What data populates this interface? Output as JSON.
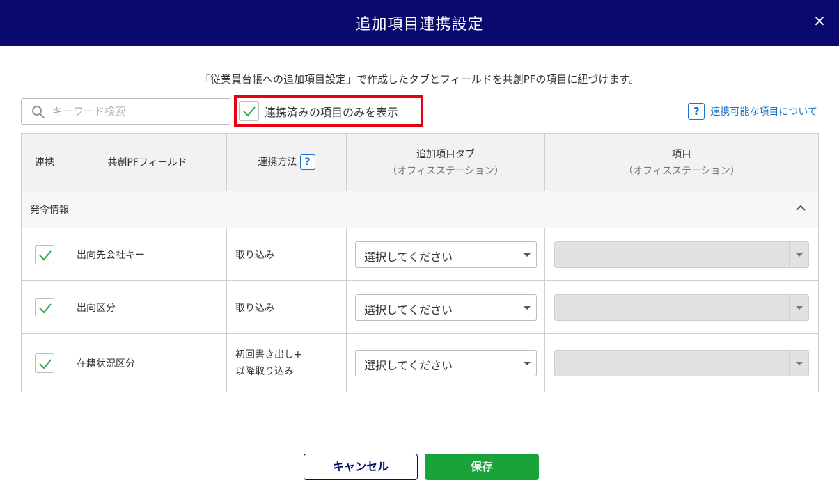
{
  "dialog": {
    "title": "追加項目連携設定",
    "close_label": "×",
    "description": "「従業員台帳への追加項目設定」で作成したタブとフィールドを共創PFの項目に紐づけます。"
  },
  "toolbar": {
    "search_placeholder": "キーワード検索",
    "filter_label": "連携済みの項目のみを表示",
    "filter_checked": true,
    "help_icon_label": "?",
    "help_link": "連携可能な項目について"
  },
  "table": {
    "headers": {
      "link": "連携",
      "field": "共創PFフィールド",
      "method": "連携方法",
      "method_help": "?",
      "tab": "追加項目タブ",
      "tab_sub": "（オフィスステーション）",
      "item": "項目",
      "item_sub": "（オフィスステーション）"
    },
    "section": "発令情報",
    "rows": [
      {
        "checked": true,
        "field": "出向先会社キー",
        "method": "取り込み",
        "method2": "",
        "tab_select": "選択してください",
        "item_select": ""
      },
      {
        "checked": true,
        "field": "出向区分",
        "method": "取り込み",
        "method2": "",
        "tab_select": "選択してください",
        "item_select": ""
      },
      {
        "checked": true,
        "field": "在籍状況区分",
        "method": "初回書き出し+",
        "method2": "以降取り込み",
        "tab_select": "選択してください",
        "item_select": ""
      }
    ]
  },
  "footer": {
    "cancel_label": "キャンセル",
    "save_label": "保存"
  },
  "colors": {
    "header_bg": "#0a0a6e",
    "highlight": "#e60012",
    "save_bg": "#1aa33a",
    "link": "#1a73c9",
    "check": "#2ea84a"
  }
}
